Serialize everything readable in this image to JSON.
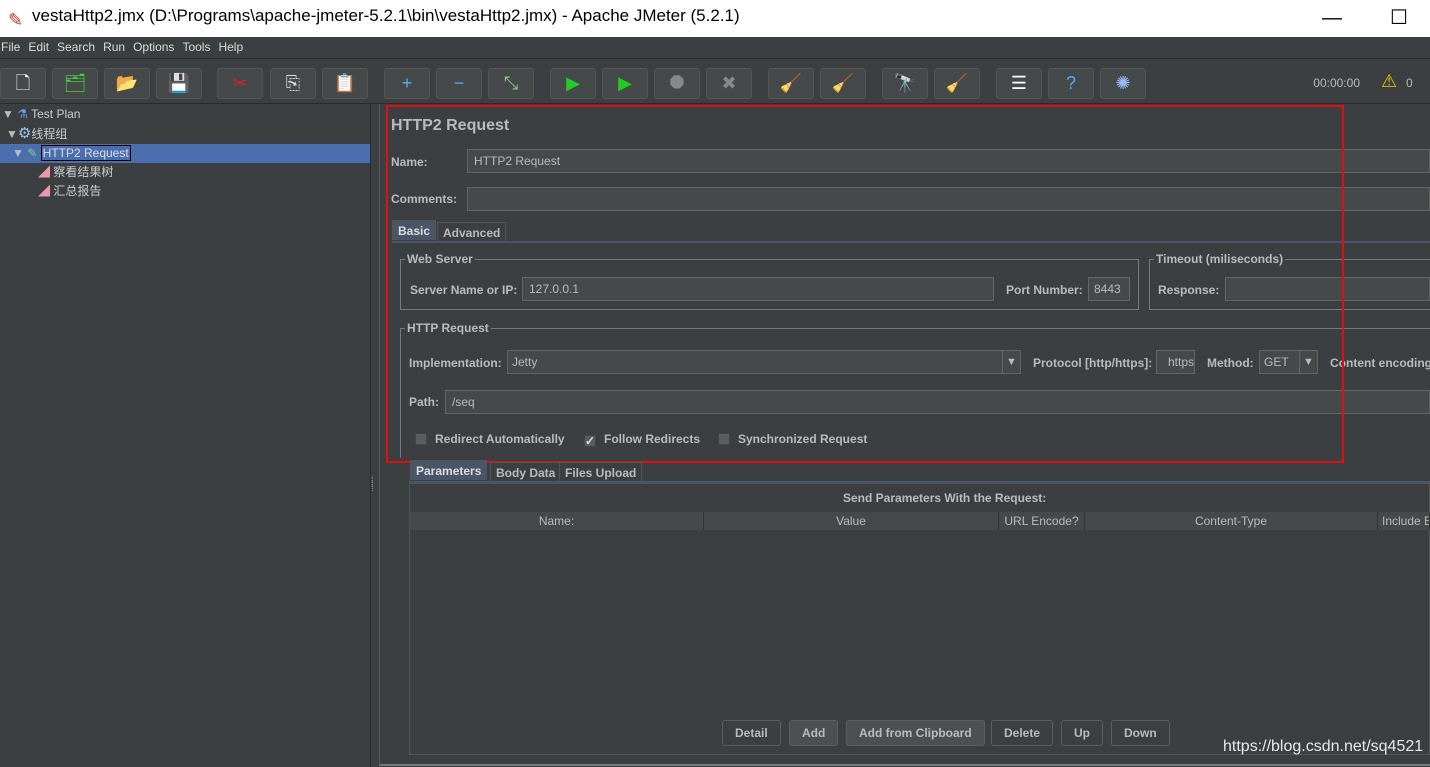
{
  "window": {
    "title": "vestaHttp2.jmx (D:\\Programs\\apache-jmeter-5.2.1\\bin\\vestaHttp2.jmx) - Apache JMeter (5.2.1)",
    "minimize": "—",
    "maximize": "☐"
  },
  "menu": [
    "File",
    "Edit",
    "Search",
    "Run",
    "Options",
    "Tools",
    "Help"
  ],
  "toolbar": {
    "buttons": [
      {
        "name": "new-icon",
        "glyph": "🗋"
      },
      {
        "name": "templates-icon",
        "glyph": "🗂"
      },
      {
        "name": "open-icon",
        "glyph": "📂"
      },
      {
        "name": "save-icon",
        "glyph": "💾"
      },
      {
        "name": "cut-icon",
        "glyph": "✂"
      },
      {
        "name": "copy-icon",
        "glyph": "⎘"
      },
      {
        "name": "paste-icon",
        "glyph": "📋"
      },
      {
        "name": "expand-icon",
        "glyph": "+"
      },
      {
        "name": "collapse-icon",
        "glyph": "−"
      },
      {
        "name": "toggle-icon",
        "glyph": "⤡"
      },
      {
        "name": "start-icon",
        "glyph": "▶"
      },
      {
        "name": "start-no-pauses-icon",
        "glyph": "▶"
      },
      {
        "name": "stop-icon",
        "glyph": "⯃"
      },
      {
        "name": "shutdown-icon",
        "glyph": "✖"
      },
      {
        "name": "clear-icon",
        "glyph": "🧹"
      },
      {
        "name": "clear-all-icon",
        "glyph": "🧹"
      },
      {
        "name": "search-icon",
        "glyph": "🔭"
      },
      {
        "name": "reset-search-icon",
        "glyph": "🧹"
      },
      {
        "name": "function-helper-icon",
        "glyph": "☰"
      },
      {
        "name": "help-icon",
        "glyph": "?"
      },
      {
        "name": "remote-icon",
        "glyph": "✺"
      }
    ],
    "timer": "00:00:00",
    "warning_count": "0"
  },
  "tree": [
    {
      "label": "Test Plan",
      "icon": "flask-icon"
    },
    {
      "label": "线程组",
      "icon": "gear-icon"
    },
    {
      "label": "HTTP2 Request",
      "icon": "pipette-icon",
      "selected": true
    },
    {
      "label": "察看结果树",
      "icon": "listener-icon"
    },
    {
      "label": "汇总报告",
      "icon": "listener-icon"
    }
  ],
  "panel": {
    "title": "HTTP2 Request",
    "name_label": "Name:",
    "name_value": "HTTP2 Request",
    "comments_label": "Comments:",
    "comments_value": "",
    "tabs": [
      "Basic",
      "Advanced"
    ],
    "web_server": {
      "title": "Web Server",
      "server_label": "Server Name or IP:",
      "server_value": "127.0.0.1",
      "port_label": "Port Number:",
      "port_value": "8443"
    },
    "timeout": {
      "title": "Timeout (miliseconds)",
      "response_label": "Response:",
      "response_value": ""
    },
    "http_request": {
      "title": "HTTP Request",
      "impl_label": "Implementation:",
      "impl_value": "Jetty",
      "protocol_label": "Protocol [http/https]:",
      "protocol_value": "https",
      "method_label": "Method:",
      "method_value": "GET",
      "encoding_label": "Content encoding:",
      "path_label": "Path:",
      "path_value": "/seq"
    },
    "checkboxes": [
      {
        "label": "Redirect Automatically",
        "checked": false
      },
      {
        "label": "Follow Redirects",
        "checked": true
      },
      {
        "label": "Synchronized Request",
        "checked": false
      }
    ],
    "sub_tabs": [
      "Parameters",
      "Body Data",
      "Files Upload"
    ],
    "params_title": "Send Parameters With the Request:",
    "columns": [
      "Name:",
      "Value",
      "URL Encode?",
      "Content-Type",
      "Include Equals?"
    ],
    "buttons": [
      "Detail",
      "Add",
      "Add from Clipboard",
      "Delete",
      "Up",
      "Down"
    ]
  },
  "watermark": "https://blog.csdn.net/sq4521",
  "colors": {
    "background": "#3c3f41",
    "selection": "#4b6eaf",
    "highlight_box": "#e01010"
  }
}
